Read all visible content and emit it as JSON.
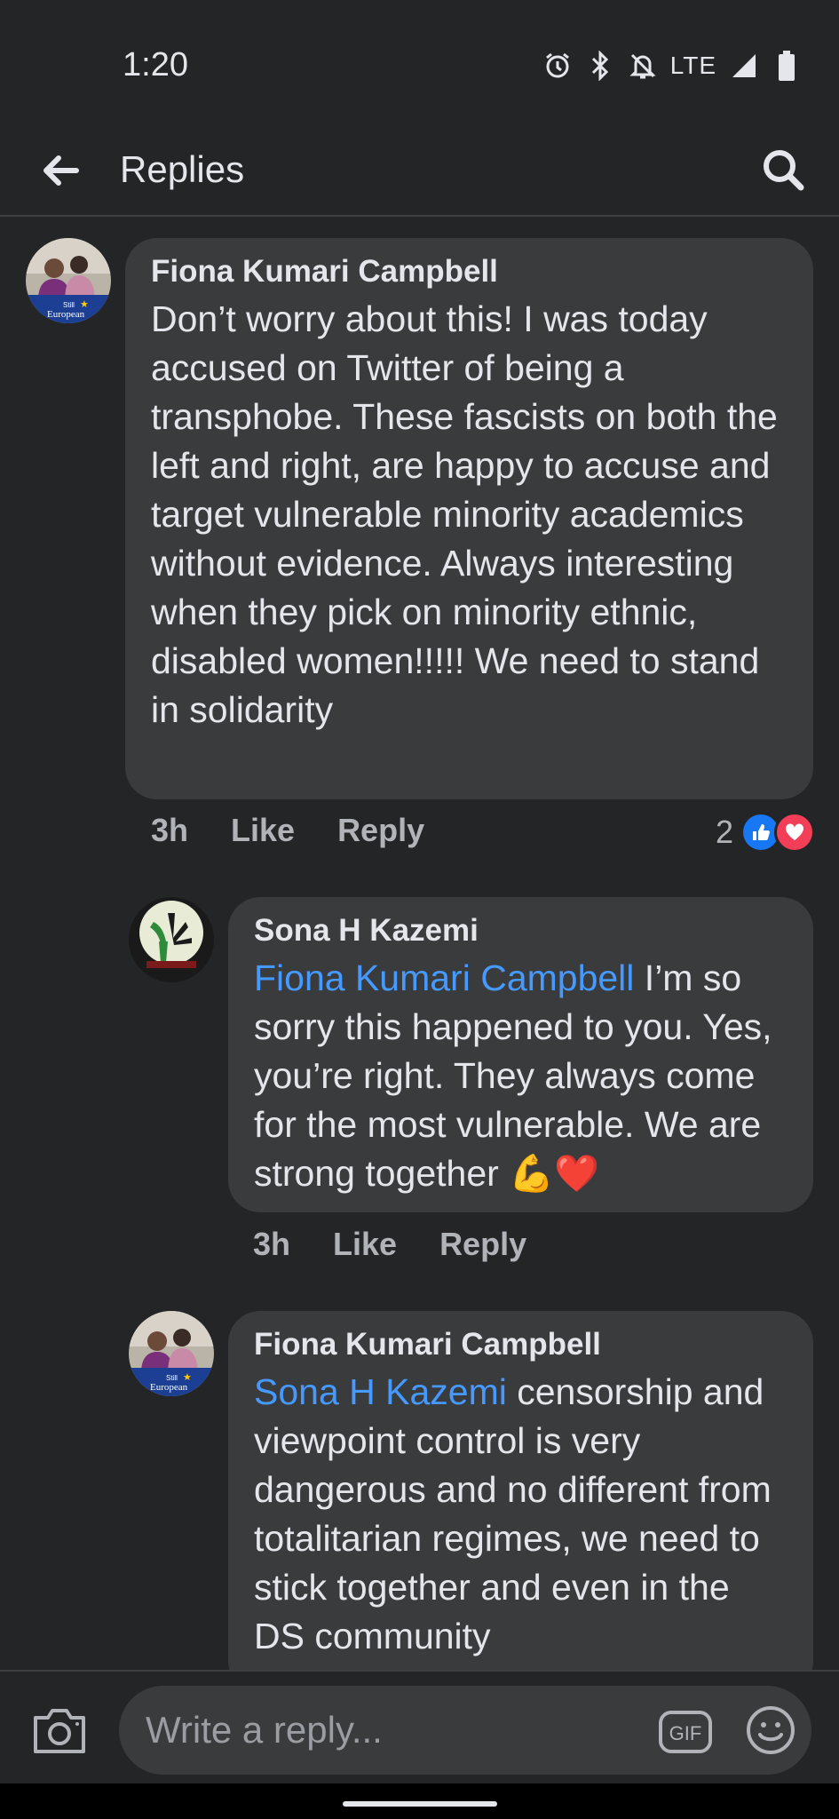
{
  "status_bar": {
    "time": "1:20",
    "network": "LTE"
  },
  "header": {
    "title": "Replies"
  },
  "comments": [
    {
      "author": "Fiona Kumari Campbell",
      "mention": "",
      "text": "Don’t worry about this! I was today accused on Twitter of being a transphobe. These fascists on both the left and right, are happy to accuse and target vulnerable minority academics without evidence. Always interesting when they pick on minority ethnic, disabled women!!!!! We need to stand in solidarity",
      "time": "3h",
      "like_label": "Like",
      "reply_label": "Reply",
      "reaction_count": "2",
      "avatar_caption_top": "Still",
      "avatar_caption_bottom": "European"
    },
    {
      "author": "Sona H Kazemi",
      "mention": "Fiona Kumari Campbell",
      "text": " I’m so sorry this happened to you. Yes, you’re right. They always come for the most vulnerable. We are strong together 💪❤️",
      "time": "3h",
      "like_label": "Like",
      "reply_label": "Reply"
    },
    {
      "author": "Fiona Kumari Campbell",
      "mention": "Sona H Kazemi",
      "text": " censorship and viewpoint control is very dangerous and no different from totalitarian regimes, we need to stick together and even in the DS community",
      "avatar_caption_top": "Still",
      "avatar_caption_bottom": "European"
    }
  ],
  "composer": {
    "placeholder": "Write a reply...",
    "gif_label": "GIF"
  },
  "colors": {
    "background": "#242526",
    "bubble": "#3a3b3c",
    "mention": "#4599ff",
    "like_blue": "#1877f2",
    "love_red": "#f33e58"
  },
  "icons": [
    "back-arrow-icon",
    "search-icon",
    "alarm-icon",
    "bluetooth-icon",
    "notifications-off-icon",
    "signal-icon",
    "battery-icon",
    "like-reaction-icon",
    "love-reaction-icon",
    "camera-icon",
    "gif-icon",
    "emoji-icon"
  ]
}
